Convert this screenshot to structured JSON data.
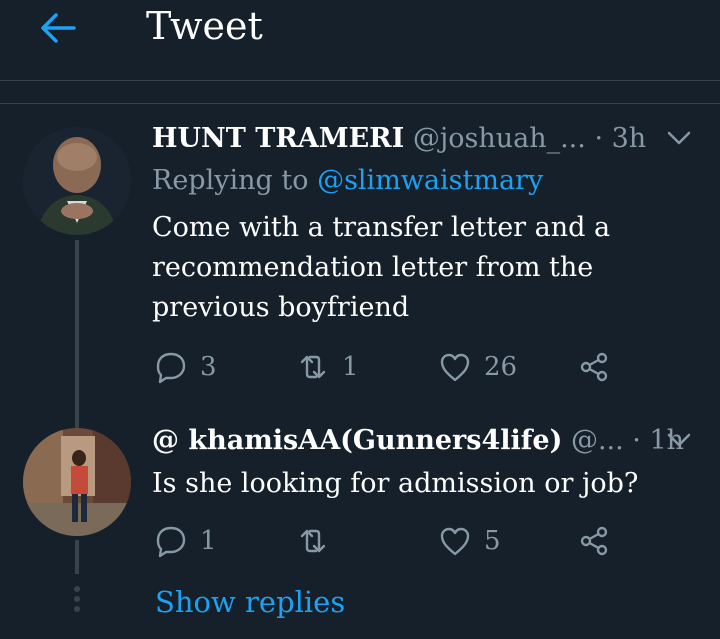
{
  "header": {
    "title": "Tweet",
    "back_icon": "arrow-left-icon",
    "accent": "#1da1f2"
  },
  "tweets": [
    {
      "name": "HUNT TRAMERI",
      "handle": "@joshuah_...",
      "dot": "·",
      "time": "3h",
      "replying_prefix": "Replying to ",
      "replying_to": "@slimwaistmary",
      "text_lines": [
        "Come with a transfer letter and a",
        "recommendation letter from the",
        "previous boyfriend"
      ],
      "replies": "3",
      "retweets": "1",
      "likes": "26"
    },
    {
      "name": "@ khamisAA(Gunners4life)",
      "handle": "@...",
      "dot": "·",
      "time": "1h",
      "text_lines": [
        "Is she looking for admission or job?"
      ],
      "replies": "1",
      "retweets": "",
      "likes": "5"
    }
  ],
  "show_replies": "Show replies",
  "colors": {
    "background": "#15202b",
    "muted": "#8899a6",
    "divider": "#38444d",
    "text": "#ffffff"
  }
}
